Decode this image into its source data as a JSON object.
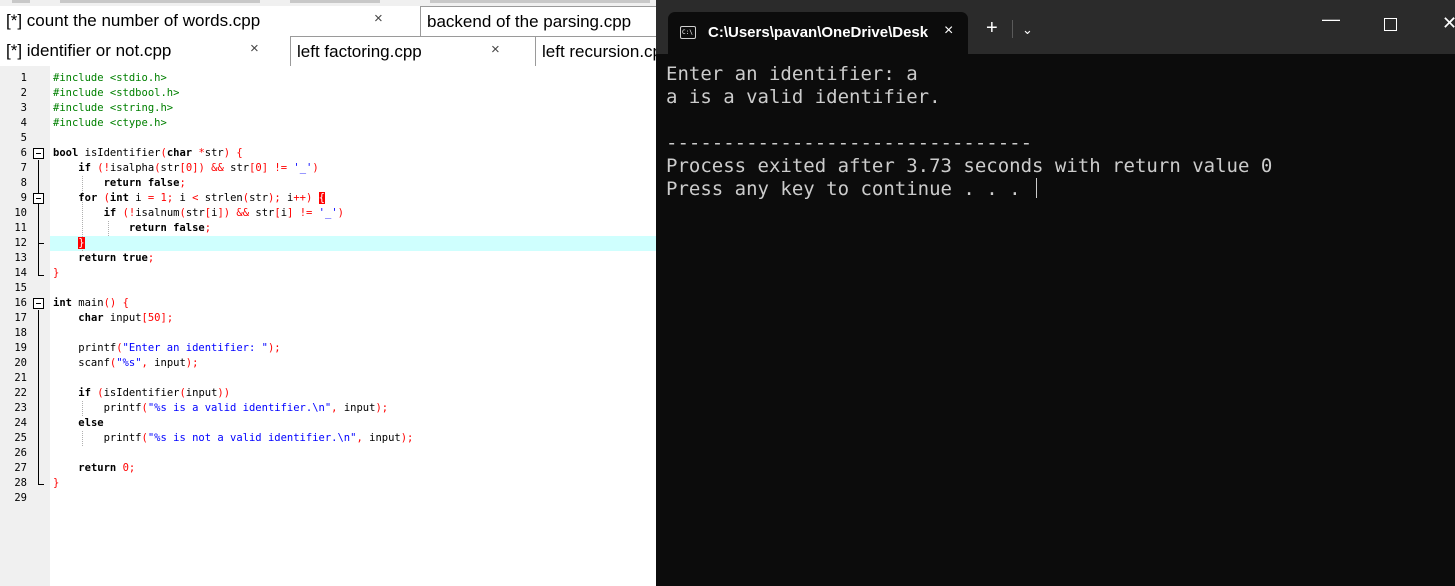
{
  "editor": {
    "tabs_row1": [
      {
        "label": "[*] count the number of words.cpp",
        "close": "×"
      },
      {
        "label": "backend of the parsing.cpp",
        "close": ""
      }
    ],
    "tabs_row2": [
      {
        "label": "[*] identifier or not.cpp",
        "close": "×"
      },
      {
        "label": "left factoring.cpp",
        "close": "×"
      },
      {
        "label": "left recursion.cpp",
        "close": ""
      }
    ],
    "line_numbers": [
      "1",
      "2",
      "3",
      "4",
      "5",
      "6",
      "7",
      "8",
      "9",
      "10",
      "11",
      "12",
      "13",
      "14",
      "15",
      "16",
      "17",
      "18",
      "19",
      "20",
      "21",
      "22",
      "23",
      "24",
      "25",
      "26",
      "27",
      "28",
      "29"
    ]
  },
  "terminal": {
    "tab_title": "C:\\Users\\pavan\\OneDrive\\Desktop",
    "tab_icon": "C:\\",
    "tab_close": "×",
    "new_tab": "+",
    "dropdown": "⌄",
    "minimize": "—",
    "close": "✕",
    "output": [
      "Enter an identifier: a",
      "a is a valid identifier.",
      "",
      "--------------------------------",
      "Process exited after 3.73 seconds with return value 0",
      "Press any key to continue . . . "
    ]
  }
}
